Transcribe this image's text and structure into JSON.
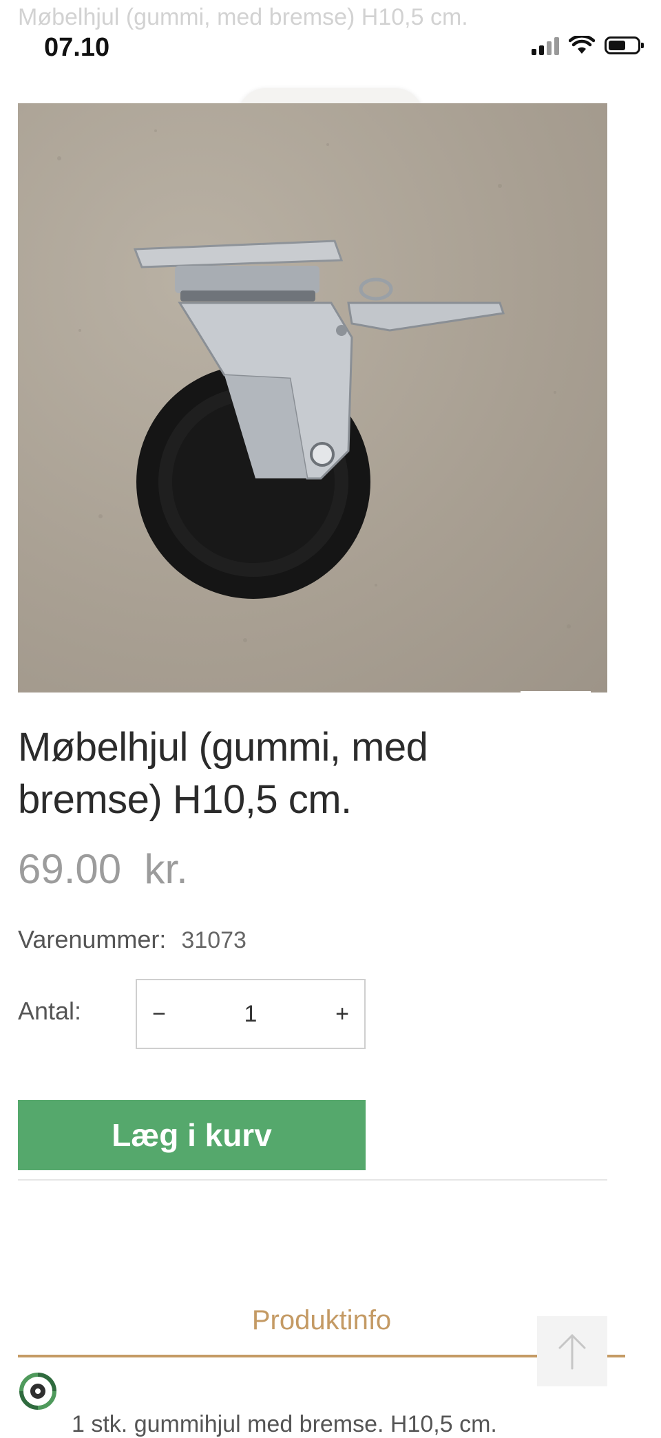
{
  "header": {
    "faded_title": "Møbelhjul (gummi, med bremse) H10,5 cm.",
    "time": "07.10",
    "url": "traevarer.dk"
  },
  "product": {
    "image_icon": "caster-wheel-photo",
    "zoom_icon": "expand-icon",
    "title": "Møbelhjul (gummi, med bremse) H10,5 cm.",
    "price": "69.00  kr.",
    "sku_label": "Varenummer:",
    "sku_value": "31073",
    "qty_label": "Antal:",
    "qty_value": "1",
    "qty_minus": "−",
    "qty_plus": "+",
    "add_to_cart": "Læg i kurv"
  },
  "tabs": {
    "active": "Produktinfo"
  },
  "description": "1 stk. gummihjul med bremse. H10,5 cm.",
  "colors": {
    "accent": "#c49a64",
    "button": "#55a86c",
    "price": "#9c9c9c"
  }
}
